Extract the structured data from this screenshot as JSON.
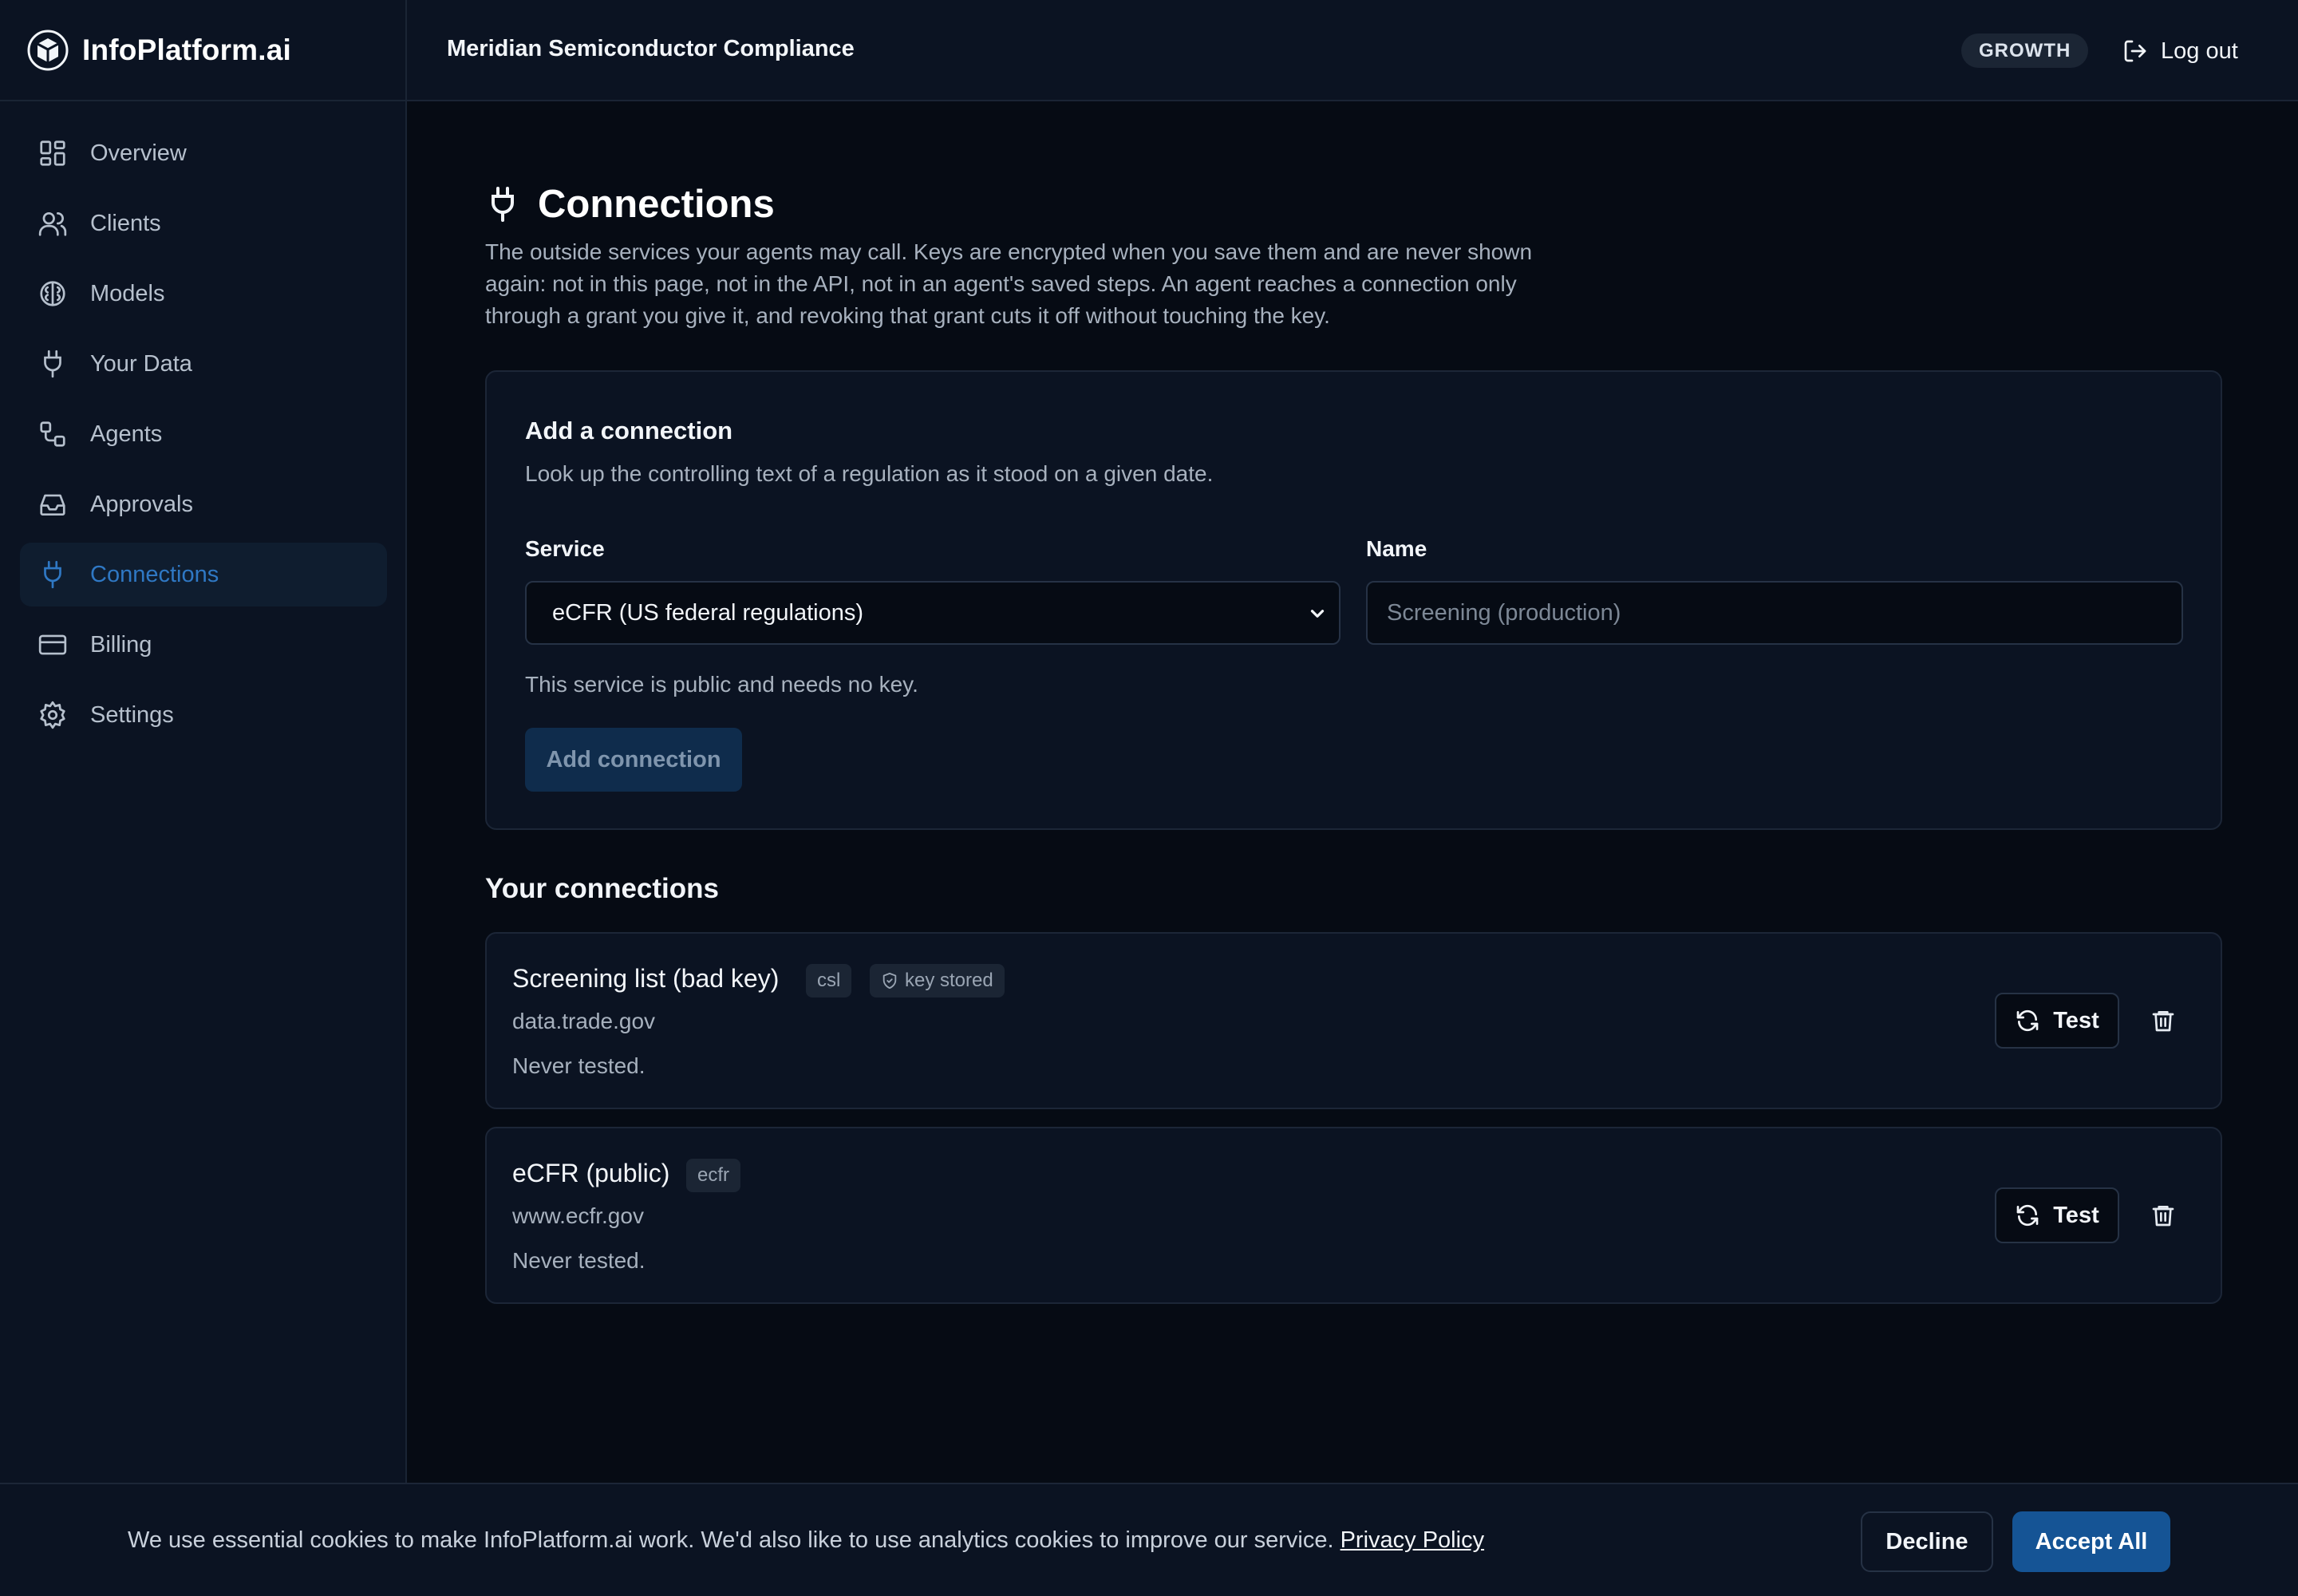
{
  "brand": {
    "name": "InfoPlatform.ai",
    "icon": "cube-logo-icon"
  },
  "header": {
    "org_name": "Meridian Semiconductor Compliance",
    "plan_badge": "GROWTH",
    "logout_label": "Log out"
  },
  "sidebar": {
    "items": [
      {
        "label": "Overview",
        "icon": "grid-icon",
        "active": false
      },
      {
        "label": "Clients",
        "icon": "users-icon",
        "active": false
      },
      {
        "label": "Models",
        "icon": "brain-icon",
        "active": false
      },
      {
        "label": "Your Data",
        "icon": "plug-icon",
        "active": false
      },
      {
        "label": "Agents",
        "icon": "workflow-icon",
        "active": false
      },
      {
        "label": "Approvals",
        "icon": "inbox-icon",
        "active": false
      },
      {
        "label": "Connections",
        "icon": "plug-icon",
        "active": true
      },
      {
        "label": "Billing",
        "icon": "credit-card-icon",
        "active": false
      },
      {
        "label": "Settings",
        "icon": "gear-icon",
        "active": false
      }
    ]
  },
  "page": {
    "title": "Connections",
    "description": "The outside services your agents may call. Keys are encrypted when you save them and are never shown again: not in this page, not in the API, not in an agent's saved steps. An agent reaches a connection only through a grant you give it, and revoking that grant cuts it off without touching the key."
  },
  "add_form": {
    "title": "Add a connection",
    "description": "Look up the controlling text of a regulation as it stood on a given date.",
    "service_label": "Service",
    "service_value": "eCFR (US federal regulations)",
    "name_label": "Name",
    "name_placeholder": "Screening (production)",
    "name_value": "",
    "key_note": "This service is public and needs no key.",
    "submit_label": "Add connection"
  },
  "connections": {
    "title": "Your connections",
    "items": [
      {
        "name": "Screening list (bad key)",
        "type_tag": "csl",
        "key_tag": "key stored",
        "host": "data.trade.gov",
        "status": "Never tested.",
        "test_label": "Test"
      },
      {
        "name": "eCFR (public)",
        "type_tag": "ecfr",
        "host": "www.ecfr.gov",
        "status": "Never tested.",
        "test_label": "Test"
      }
    ]
  },
  "cookie_banner": {
    "text": "We use essential cookies to make InfoPlatform.ai work. We'd also like to use analytics cookies to improve our service.",
    "link_label": "Privacy Policy",
    "decline_label": "Decline",
    "accept_label": "Accept All"
  },
  "colors": {
    "background": "#060b14",
    "panel": "#0b1322",
    "accent": "#2f78c4",
    "primary_button": "#155495",
    "disabled_button": "#0f2c4c"
  }
}
